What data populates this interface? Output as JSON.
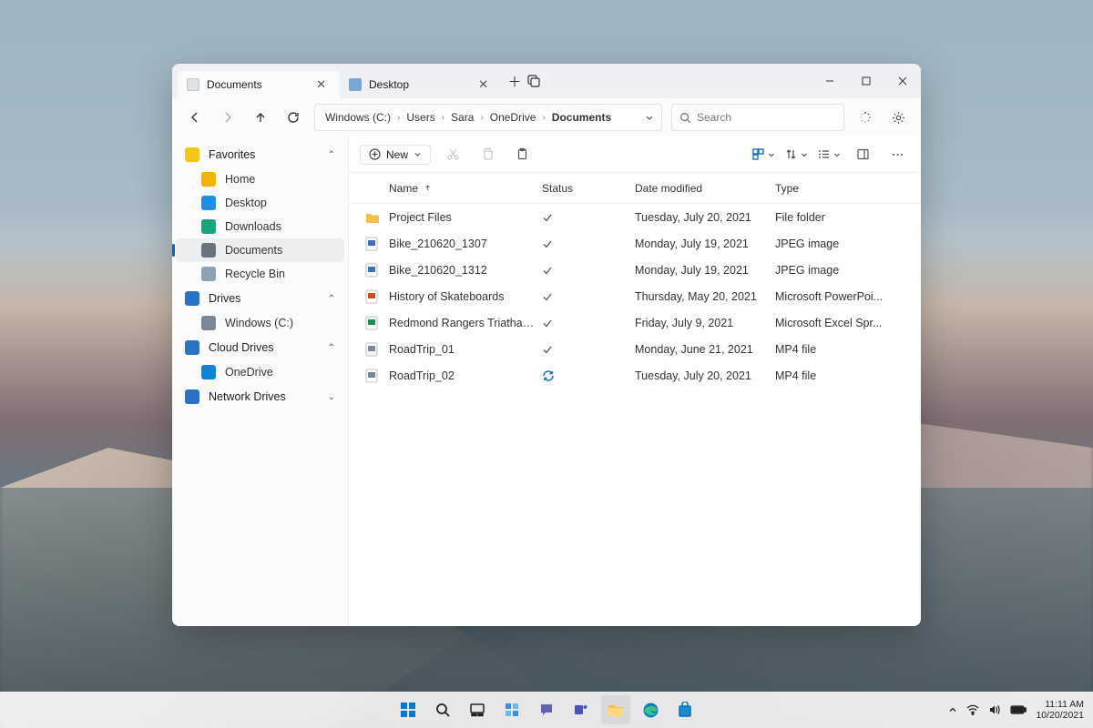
{
  "tabs": [
    {
      "label": "Documents",
      "active": true,
      "icon": "doc"
    },
    {
      "label": "Desktop",
      "active": false,
      "icon": "desk"
    }
  ],
  "breadcrumb": [
    "Windows (C:)",
    "Users",
    "Sara",
    "OneDrive",
    "Documents"
  ],
  "search": {
    "placeholder": "Search"
  },
  "toolbar": {
    "new_label": "New"
  },
  "sidebar": {
    "sections": [
      {
        "label": "Favorites",
        "icon": "#f5c518",
        "expanded": true,
        "items": [
          {
            "label": "Home",
            "icon": "#f5b20a"
          },
          {
            "label": "Desktop",
            "icon": "#1f8fe6"
          },
          {
            "label": "Downloads",
            "icon": "#1aa37c"
          },
          {
            "label": "Documents",
            "icon": "#6a7480",
            "selected": true
          },
          {
            "label": "Recycle Bin",
            "icon": "#8aa2b2"
          }
        ]
      },
      {
        "label": "Drives",
        "icon": "#2b72c4",
        "expanded": true,
        "items": [
          {
            "label": "Windows (C:)",
            "icon": "#7a8896"
          }
        ]
      },
      {
        "label": "Cloud Drives",
        "icon": "#2b72c4",
        "expanded": true,
        "items": [
          {
            "label": "OneDrive",
            "icon": "#1184d8"
          }
        ]
      },
      {
        "label": "Network Drives",
        "icon": "#2b72c4",
        "expanded": false,
        "items": []
      }
    ]
  },
  "columns": {
    "name": "Name",
    "status": "Status",
    "date": "Date modified",
    "type": "Type"
  },
  "files": [
    {
      "name": "Project Files",
      "status": "check",
      "date": "Tuesday, July 20, 2021",
      "type": "File folder",
      "kind": "folder",
      "color": "#f5c04a"
    },
    {
      "name": "Bike_210620_1307",
      "status": "check",
      "date": "Monday, July 19, 2021",
      "type": "JPEG image",
      "kind": "image",
      "color": "#3c6fb7"
    },
    {
      "name": "Bike_210620_1312",
      "status": "check",
      "date": "Monday, July 19, 2021",
      "type": "JPEG image",
      "kind": "image",
      "color": "#3c6fb7"
    },
    {
      "name": "History of Skateboards",
      "status": "check",
      "date": "Thursday, May 20, 2021",
      "type": "Microsoft PowerPoi...",
      "kind": "ppt",
      "color": "#d24726"
    },
    {
      "name": "Redmond Rangers Triathalon",
      "status": "check",
      "date": "Friday, July 9, 2021",
      "type": "Microsoft Excel Spr...",
      "kind": "xls",
      "color": "#1d8f5a"
    },
    {
      "name": "RoadTrip_01",
      "status": "check",
      "date": "Monday, June 21, 2021",
      "type": "MP4 file",
      "kind": "video",
      "color": "#7a8896"
    },
    {
      "name": "RoadTrip_02",
      "status": "sync",
      "date": "Tuesday, July 20, 2021",
      "type": "MP4 file",
      "kind": "video",
      "color": "#7a8896"
    }
  ],
  "systray": {
    "time": "11:11 AM",
    "date": "10/20/2021"
  }
}
